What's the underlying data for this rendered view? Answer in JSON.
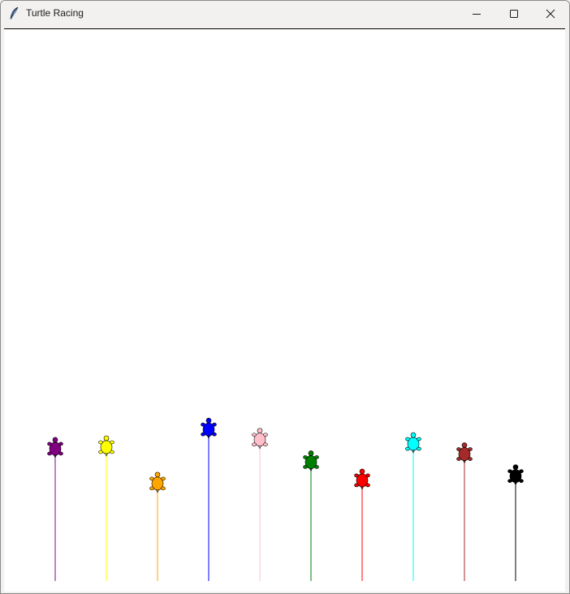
{
  "window": {
    "title": "Turtle Racing",
    "icon": "feather-icon",
    "controls": [
      "minimize-icon",
      "maximize-icon",
      "close-icon"
    ]
  },
  "race": {
    "turtles": [
      {
        "color": "purple",
        "progress": 0.247
      },
      {
        "color": "yellow",
        "progress": 0.25
      },
      {
        "color": "orange",
        "progress": 0.182
      },
      {
        "color": "blue",
        "progress": 0.283
      },
      {
        "color": "pink",
        "progress": 0.264
      },
      {
        "color": "green",
        "progress": 0.222
      },
      {
        "color": "red",
        "progress": 0.188
      },
      {
        "color": "cyan",
        "progress": 0.256
      },
      {
        "color": "brown",
        "progress": 0.237
      },
      {
        "color": "black",
        "progress": 0.196
      }
    ]
  }
}
